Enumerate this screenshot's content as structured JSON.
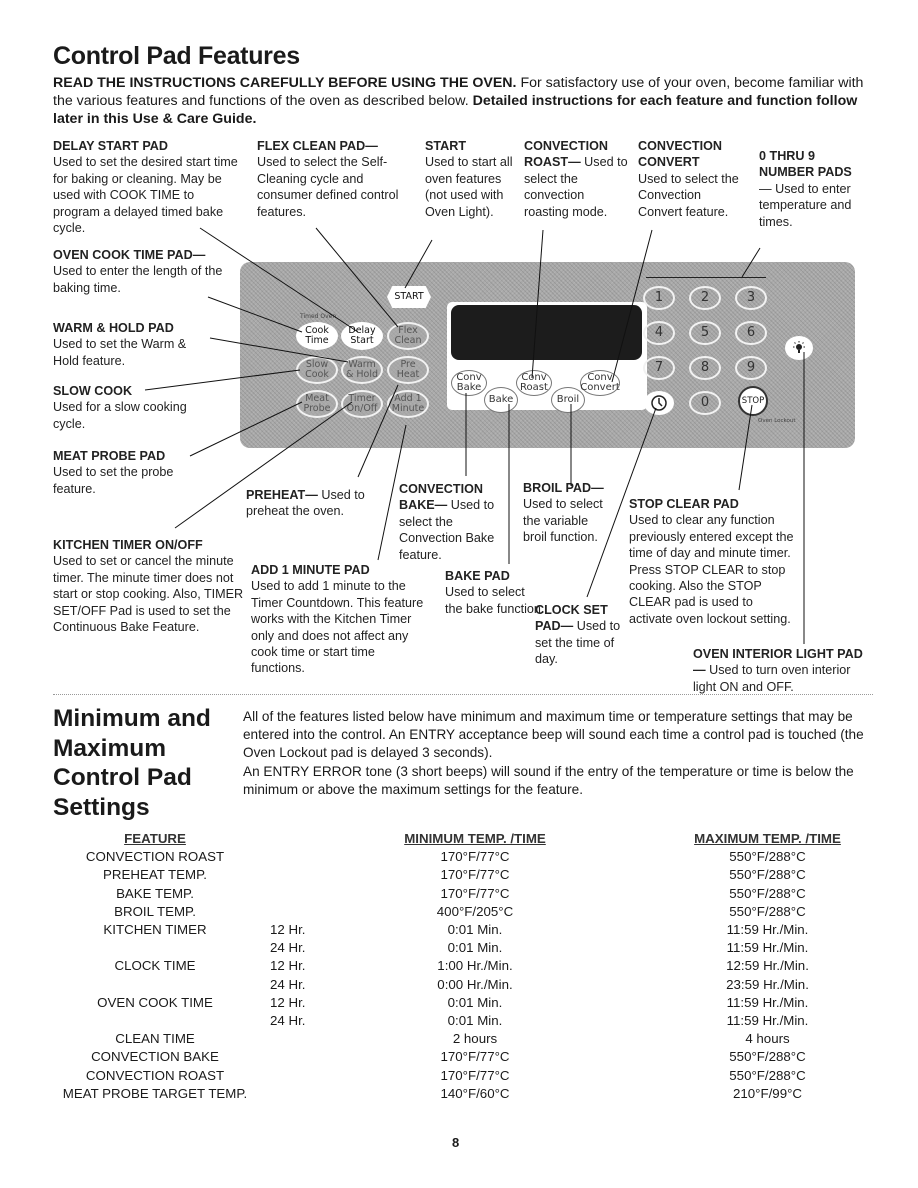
{
  "title": "Control Pad Features",
  "intro": {
    "bold1": "READ THE INSTRUCTIONS CAREFULLY BEFORE USING THE OVEN.",
    "text1": " For satisfactory use of your oven, become familiar with the various features and functions of the oven as described below. ",
    "bold2": "Detailed instructions for each feature and function follow later in this Use & Care Guide."
  },
  "callouts": {
    "delay_start": {
      "heading": "DELAY START PAD",
      "text": "Used to set the desired start time for baking or cleaning. May be used with COOK TIME to program a delayed timed bake cycle."
    },
    "flex_clean": {
      "heading": "FLEX CLEAN PAD—",
      "text": "Used to select the Self-Cleaning cycle and consumer defined control features."
    },
    "start": {
      "heading": "START",
      "text": "Used to start all oven features (not used with Oven Light)."
    },
    "conv_roast": {
      "heading": "CONVECTION ROAST—",
      "text": " Used to select the convection roasting mode."
    },
    "conv_convert": {
      "heading": "CONVECTION CONVERT",
      "text": "Used to select the Convection Convert feature."
    },
    "number_pads": {
      "heading": "0 THRU 9 NUMBER PADS",
      "text": "— Used to enter temperature and times."
    },
    "oven_cook_time": {
      "heading": "OVEN COOK TIME PAD—",
      "text": " Used to enter the length of the baking time."
    },
    "warm_hold": {
      "heading": "WARM & HOLD PAD",
      "text": "Used to set the Warm & Hold feature."
    },
    "slow_cook": {
      "heading": "SLOW COOK",
      "text": "Used for a slow cooking cycle."
    },
    "meat_probe": {
      "heading": "MEAT PROBE PAD",
      "text": "Used to set the probe feature."
    },
    "kitchen_timer": {
      "heading": "KITCHEN TIMER ON/OFF",
      "text": "Used to set or cancel the minute timer. The minute timer does not start or stop cooking. Also, TIMER SET/OFF Pad is used to set the Continuous Bake Feature."
    },
    "preheat": {
      "heading": "PREHEAT—",
      "text": " Used to preheat the oven."
    },
    "add_minute": {
      "heading": "ADD 1 MINUTE PAD",
      "text": "Used to add 1 minute to the Timer Countdown. This feature works with the Kitchen Timer only and does not affect any cook time or start time functions."
    },
    "conv_bake": {
      "heading": "CONVECTION BAKE—",
      "text": " Used to select the Convection Bake feature."
    },
    "bake": {
      "heading": "BAKE PAD",
      "text": "Used to select the bake function."
    },
    "broil": {
      "heading": "BROIL PAD—",
      "text": " Used to select the variable broil function."
    },
    "clock_set": {
      "heading": "CLOCK SET PAD—",
      "text": " Used to set the time of day."
    },
    "stop_clear": {
      "heading": "STOP CLEAR PAD",
      "text": "Used to clear any function previously entered except the time of day and minute timer. Press STOP CLEAR to stop cooking. Also the STOP CLEAR pad is used to activate oven lockout setting."
    },
    "oven_light": {
      "heading": "OVEN INTERIOR LIGHT PAD—",
      "text": " Used to turn oven interior light ON and OFF."
    }
  },
  "panel": {
    "start_label": "START",
    "timed_oven_label": "Timed Oven",
    "left_pads": [
      [
        "Cook Time",
        "Delay Start",
        "Flex Clean"
      ],
      [
        "Slow Cook",
        "Warm & Hold",
        "Pre Heat"
      ],
      [
        "Meat Probe",
        "Timer On/Off",
        "Add 1 Minute"
      ]
    ],
    "function_pads": [
      "Conv Bake",
      "Bake",
      "Conv Roast",
      "Broil",
      "Conv Convert"
    ],
    "number_pads": [
      "1",
      "2",
      "3",
      "4",
      "5",
      "6",
      "7",
      "8",
      "9",
      "0"
    ],
    "stop_label": "STOP",
    "lock_label": "Oven Lockout",
    "icons": {
      "clock": "clock-icon",
      "light": "light-bulb-icon",
      "lock": "lock-icon"
    }
  },
  "section": {
    "heading": "Minimum and Maximum Control Pad Settings",
    "para1": "All of the features listed below have minimum and maximum time or temperature settings that may be entered into the control. An ENTRY acceptance beep will sound each time a control pad is touched (the Oven Lockout  pad is delayed 3 seconds).",
    "para2": "An ENTRY ERROR tone (3 short beeps) will sound if the entry of the temperature or time is below the minimum or above the maximum settings for the feature."
  },
  "table": {
    "headers": [
      "FEATURE",
      "",
      "MINIMUM TEMP. /TIME",
      "MAXIMUM TEMP. /TIME"
    ],
    "rows": [
      [
        "CONVECTION ROAST",
        "",
        "170°F/77°C",
        "550°F/288°C"
      ],
      [
        "PREHEAT TEMP.",
        "",
        "170°F/77°C",
        "550°F/288°C"
      ],
      [
        "BAKE  TEMP.",
        "",
        "170°F/77°C",
        "550°F/288°C"
      ],
      [
        "BROIL TEMP.",
        "",
        "400°F/205°C",
        "550°F/288°C"
      ],
      [
        "KITCHEN TIMER",
        "12 Hr.",
        "0:01 Min.",
        "11:59 Hr./Min."
      ],
      [
        "",
        "24 Hr.",
        "0:01 Min.",
        "11:59 Hr./Min."
      ],
      [
        "CLOCK TIME",
        "12 Hr.",
        "1:00 Hr./Min.",
        "12:59 Hr./Min."
      ],
      [
        "",
        "24 Hr.",
        "0:00 Hr./Min.",
        "23:59 Hr./Min."
      ],
      [
        "OVEN COOK TIME",
        "12 Hr.",
        "0:01 Min.",
        "11:59 Hr./Min."
      ],
      [
        "",
        "24 Hr.",
        "0:01 Min.",
        "11:59 Hr./Min."
      ],
      [
        "CLEAN TIME",
        "",
        "2 hours",
        "4 hours"
      ],
      [
        "CONVECTION BAKE",
        "",
        "170°F/77°C",
        "550°F/288°C"
      ],
      [
        "CONVECTION ROAST",
        "",
        "170°F/77°C",
        "550°F/288°C"
      ],
      [
        "MEAT PROBE TARGET TEMP.",
        "",
        "140°F/60°C",
        "210°F/99°C"
      ]
    ]
  },
  "page_number": "8"
}
